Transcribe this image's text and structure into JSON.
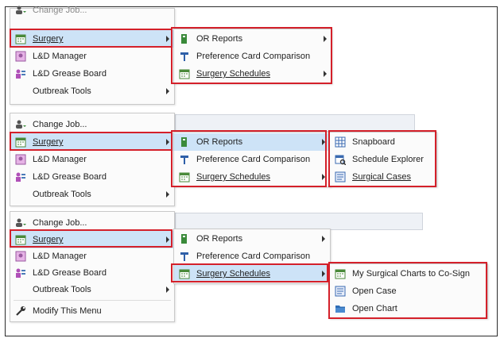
{
  "top": {
    "change_job": "Change Job...",
    "surgery": "Surgery",
    "ld_manager": "L&D Manager",
    "ld_grease": "L&D Grease Board",
    "outbreak": "Outbreak Tools",
    "sub_or_reports": "OR Reports",
    "sub_pref": "Preference Card Comparison",
    "sub_sched": "Surgery Schedules"
  },
  "mid": {
    "change_job": "Change Job...",
    "surgery": "Surgery",
    "ld_manager": "L&D Manager",
    "ld_grease": "L&D Grease Board",
    "outbreak": "Outbreak Tools",
    "sub_or_reports": "OR Reports",
    "sub_pref": "Preference Card Comparison",
    "sub_sched": "Surgery Schedules",
    "snapboard": "Snapboard",
    "schedule_explorer": "Schedule Explorer",
    "surgical_cases": "Surgical Cases"
  },
  "bottom": {
    "change_job": "Change Job...",
    "surgery": "Surgery",
    "ld_manager": "L&D Manager",
    "ld_grease": "L&D Grease Board",
    "outbreak": "Outbreak Tools",
    "modify": "Modify This Menu",
    "sub_or_reports": "OR Reports",
    "sub_pref": "Preference Card Comparison",
    "sub_sched": "Surgery Schedules",
    "my_charts": "My Surgical Charts to Co-Sign",
    "open_case": "Open Case",
    "open_chart": "Open Chart"
  },
  "colors": {
    "highlight": "#cde3f7",
    "annotation_red": "#d4202a",
    "menu_bg": "#fbfbfb"
  }
}
